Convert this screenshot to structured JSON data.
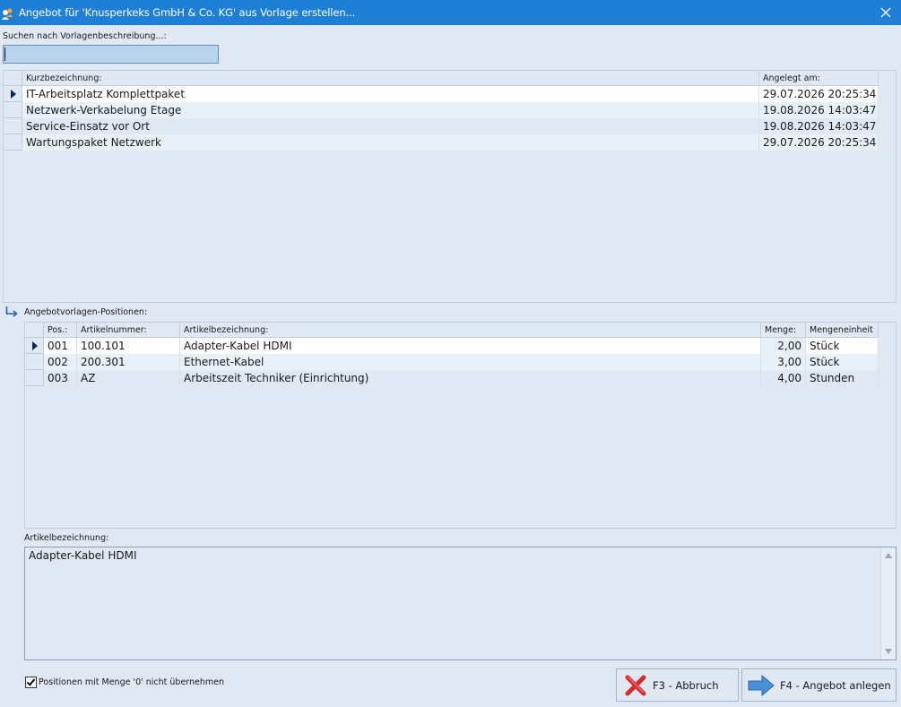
{
  "window": {
    "title": "Angebot für 'Knusperkeks GmbH & Co. KG' aus Vorlage erstellen...",
    "icon": "app-users-icon",
    "close_icon": "close-icon"
  },
  "search": {
    "label": "Suchen nach Vorlagenbeschreibung...:",
    "value": "",
    "placeholder": ""
  },
  "templates": {
    "columns": [
      "Kurzbezeichnung:",
      "Angelegt am:"
    ],
    "rows": [
      {
        "name": "IT-Arbeitsplatz Komplettpaket",
        "date": "29.07.2026 20:25:34",
        "selected": true
      },
      {
        "name": "Netzwerk-Verkabelung Etage",
        "date": "19.08.2026 14:03:47",
        "selected": false
      },
      {
        "name": "Service-Einsatz vor Ort",
        "date": "19.08.2026 14:03:47",
        "selected": false
      },
      {
        "name": "Wartungspaket Netzwerk",
        "date": "29.07.2026 20:25:34",
        "selected": false
      }
    ]
  },
  "positions": {
    "label": "Angebotvorlagen-Positionen:",
    "columns": [
      "Pos.:",
      "Artikelnummer:",
      "Artikelbezeichnung:",
      "Menge:",
      "Mengeneinheit"
    ],
    "rows": [
      {
        "pos": "001",
        "article_no": "100.101",
        "description": "Adapter-Kabel HDMI",
        "qty": "2,00",
        "unit": "Stück",
        "selected": true
      },
      {
        "pos": "002",
        "article_no": "200.301",
        "description": "Ethernet-Kabel",
        "qty": "3,00",
        "unit": "Stück",
        "selected": false
      },
      {
        "pos": "003",
        "article_no": "AZ",
        "description": "Arbeitszeit Techniker (Einrichtung)",
        "qty": "4,00",
        "unit": "Stunden",
        "selected": false
      }
    ]
  },
  "detail": {
    "label": "Artikelbezeichnung:",
    "text": "Adapter-Kabel HDMI"
  },
  "options": {
    "skip_zero_label": "Positionen mit Menge '0' nicht übernehmen",
    "skip_zero_checked": true
  },
  "buttons": {
    "cancel": {
      "label": "F3 - Abbruch",
      "icon": "red-x-icon"
    },
    "create": {
      "label": "F4 - Angebot anlegen",
      "icon": "arrow-right-icon"
    }
  },
  "colors": {
    "titlebar": "#1f7fd6",
    "window_bg": "#dfe8f3",
    "selected_row": "#ffffff",
    "alt_row": "#e8f0f8",
    "search_bg": "#b7d3ee"
  }
}
